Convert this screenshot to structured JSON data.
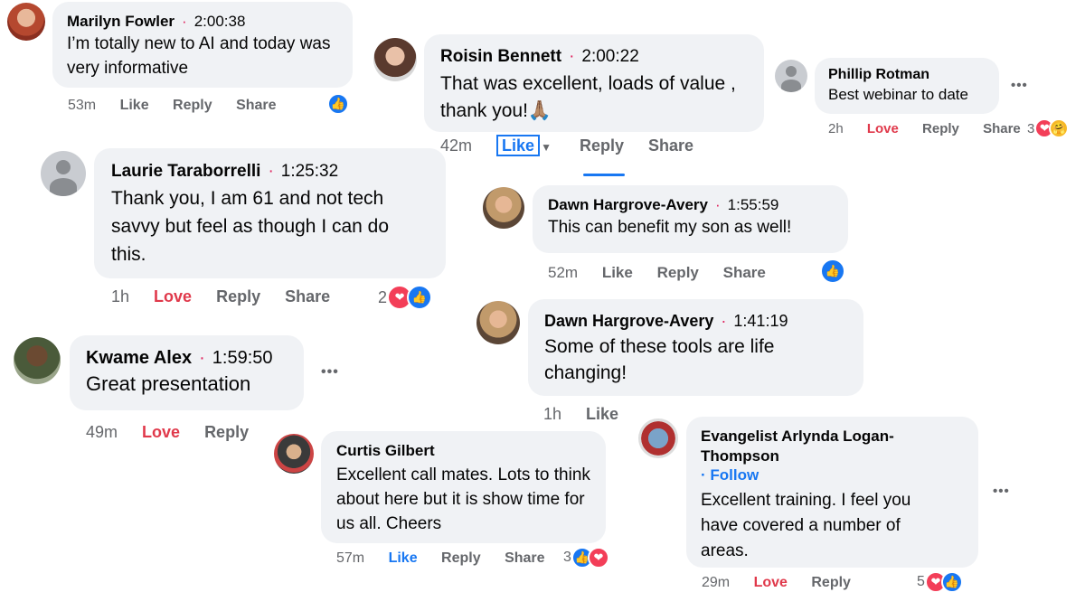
{
  "comments": [
    {
      "name": "Marilyn Fowler",
      "time": "2:00:38",
      "text": "I’m totally new to AI and today was very informative",
      "age": "53m",
      "actions": [
        "Like",
        "Reply",
        "Share"
      ]
    },
    {
      "name": "Roisin Bennett",
      "time": "2:00:22",
      "text": "That was excellent, loads of value , thank you!🙏🏽",
      "age": "42m",
      "actions": [
        "Like",
        "Reply",
        "Share"
      ]
    },
    {
      "name": "Phillip Rotman",
      "text": "Best webinar to date",
      "age": "2h",
      "actions": [
        "Love",
        "Reply",
        "Share"
      ],
      "reaction_count": "3"
    },
    {
      "name": "Laurie Taraborrelli",
      "time": "1:25:32",
      "text": "Thank you, I am 61 and not tech savvy but feel as though I can do this.",
      "age": "1h",
      "actions": [
        "Love",
        "Reply",
        "Share"
      ],
      "reaction_count": "2"
    },
    {
      "name": "Dawn Hargrove-Avery",
      "time": "1:55:59",
      "text": "This can benefit my son as well!",
      "age": "52m",
      "actions": [
        "Like",
        "Reply",
        "Share"
      ]
    },
    {
      "name": "Dawn Hargrove-Avery",
      "time": "1:41:19",
      "text": "Some of these tools are life changing!",
      "age": "1h",
      "actions": [
        "Like"
      ]
    },
    {
      "name": "Kwame Alex",
      "time": "1:59:50",
      "text": "Great presentation",
      "age": "49m",
      "actions": [
        "Love",
        "Reply"
      ]
    },
    {
      "name": "Curtis Gilbert",
      "text": "Excellent call mates. Lots to think about here but it is show time for us all. Cheers",
      "age": "57m",
      "actions": [
        "Like",
        "Reply",
        "Share"
      ],
      "reaction_count": "3"
    },
    {
      "name": "Evangelist Arlynda Logan-Thompson",
      "follow": "· Follow",
      "text": "Excellent training. I feel you have covered a number of areas.",
      "age": "29m",
      "actions": [
        "Love",
        "Reply"
      ],
      "reaction_count": "5"
    }
  ],
  "more_label": "•••",
  "icons": {
    "like": "thumbs-up-icon",
    "love": "heart-icon",
    "care": "care-icon",
    "caret": "caret-down-icon"
  },
  "colors": {
    "like": "#1877f2",
    "love": "#f33e58",
    "bubble": "#f0f2f5",
    "muted": "#65676b"
  }
}
